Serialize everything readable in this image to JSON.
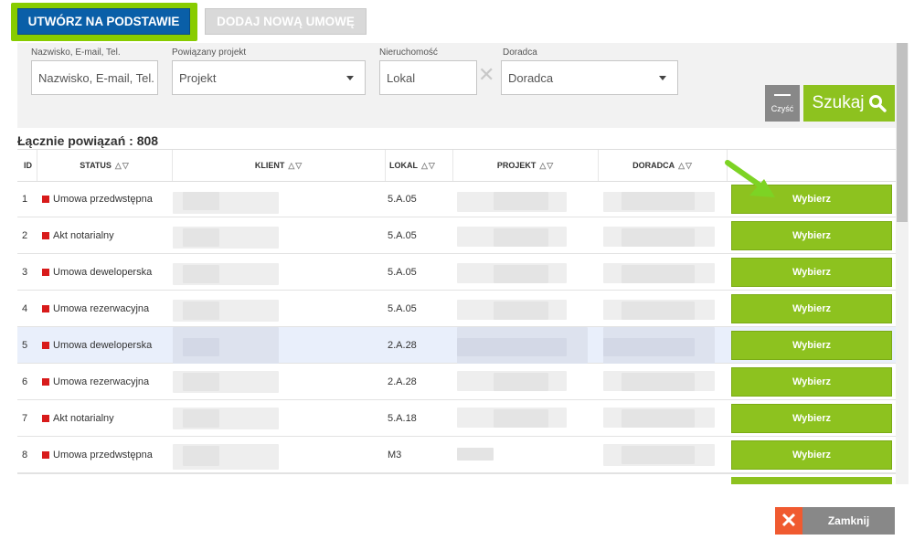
{
  "toolbar": {
    "create_based_label": "UTWÓRZ NA PODSTAWIE",
    "add_new_label": "DODAJ NOWĄ UMOWĘ"
  },
  "filters": {
    "name": {
      "label": "Nazwisko, E-mail, Tel.",
      "placeholder": "Nazwisko, E-mail, Tel."
    },
    "project": {
      "label": "Powiązany projekt",
      "value": "Projekt"
    },
    "property": {
      "label": "Nieruchomość",
      "placeholder": "Lokal"
    },
    "advisor": {
      "label": "Doradca",
      "value": "Doradca"
    },
    "clear_label": "Czyść",
    "search_label": "Szukaj"
  },
  "summary": {
    "total_label": "Łącznie powiązań : 808"
  },
  "table": {
    "headers": {
      "id": "ID",
      "status": "STATUS",
      "client": "KLIENT",
      "unit": "LOKAL",
      "project": "PROJEKT",
      "advisor": "DORADCA"
    },
    "select_label": "Wybierz",
    "status_color": "#d81b1b",
    "rows": [
      {
        "id": "1",
        "status": "Umowa przedwstępna",
        "unit": "5.A.05"
      },
      {
        "id": "2",
        "status": "Akt notarialny",
        "unit": "5.A.05"
      },
      {
        "id": "3",
        "status": "Umowa deweloperska",
        "unit": "5.A.05"
      },
      {
        "id": "4",
        "status": "Umowa rezerwacyjna",
        "unit": "5.A.05"
      },
      {
        "id": "5",
        "status": "Umowa deweloperska",
        "unit": "2.A.28"
      },
      {
        "id": "6",
        "status": "Umowa rezerwacyjna",
        "unit": "2.A.28"
      },
      {
        "id": "7",
        "status": "Akt notarialny",
        "unit": "5.A.18"
      },
      {
        "id": "8",
        "status": "Umowa przedwstępna",
        "unit": "M3"
      }
    ]
  },
  "footer": {
    "close_label": "Zamknij"
  },
  "colors": {
    "primary": "#0a5fa8",
    "accent_green": "#8dc21f",
    "close_orange": "#f05a30"
  }
}
